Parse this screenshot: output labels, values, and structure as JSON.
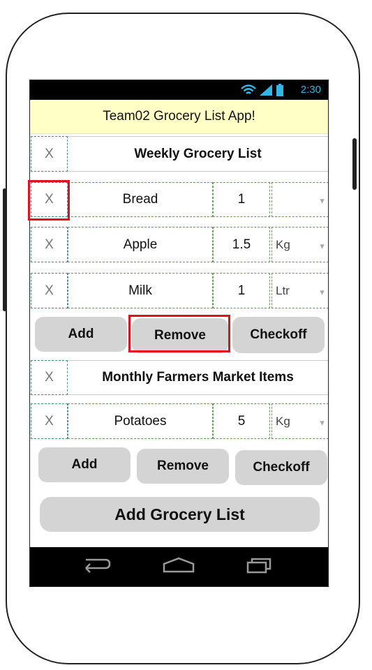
{
  "status": {
    "time": "2:30"
  },
  "app": {
    "title": "Team02 Grocery List App!"
  },
  "lists": [
    {
      "remove_glyph": "X",
      "title": "Weekly Grocery List",
      "items": [
        {
          "remove_glyph": "X",
          "name": "Bread",
          "qty": "1",
          "unit": ""
        },
        {
          "remove_glyph": "X",
          "name": "Apple",
          "qty": "1.5",
          "unit": "Kg"
        },
        {
          "remove_glyph": "X",
          "name": "Milk",
          "qty": "1",
          "unit": "Ltr"
        }
      ],
      "buttons": {
        "add": "Add",
        "remove": "Remove",
        "checkoff": "Checkoff"
      }
    },
    {
      "remove_glyph": "X",
      "title": "Monthly Farmers Market Items",
      "items": [
        {
          "remove_glyph": "X",
          "name": "Potatoes",
          "qty": "5",
          "unit": "Kg"
        }
      ],
      "buttons": {
        "add": "Add",
        "remove": "Remove",
        "checkoff": "Checkoff"
      }
    }
  ],
  "add_list_button": "Add Grocery List",
  "dropdown_arrow": "▼",
  "icons": {
    "wifi": "wifi-icon",
    "signal": "signal-icon",
    "battery": "battery-icon",
    "back": "back-icon",
    "home": "home-icon",
    "recents": "recents-icon"
  },
  "colors": {
    "highlight": "#e0111c",
    "title_bg": "#ffffc6",
    "status_text": "#33b5e5"
  }
}
